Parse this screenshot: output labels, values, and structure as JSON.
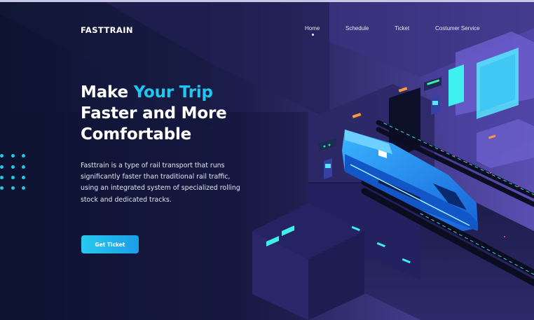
{
  "brand": {
    "name": "FASTTRAIN"
  },
  "nav": {
    "items": [
      {
        "label": "Home",
        "active": true
      },
      {
        "label": "Schedule"
      },
      {
        "label": "Ticket"
      },
      {
        "label": "Costumer Service"
      }
    ]
  },
  "hero": {
    "title_line1_prefix": "Make ",
    "title_line1_accent": "Your Trip",
    "title_line2": "Faster and More",
    "title_line3": "Comfortable",
    "description": "Fasttrain is a type of rail transport that runs significantly faster than traditional rail traffic, using an integrated system of specialized rolling stock and dedicated tracks.",
    "cta_label": "Get Ticket"
  },
  "colors": {
    "accent": "#1ec8f0",
    "background": "#0e1430",
    "illustration_purple": "#5a4fb0",
    "train_blue": "#1e8ff0",
    "neon_cyan": "#3ff0f0",
    "signal_orange": "#ff9a3c"
  },
  "illustration": {
    "name": "high-speed-train-isometric"
  }
}
